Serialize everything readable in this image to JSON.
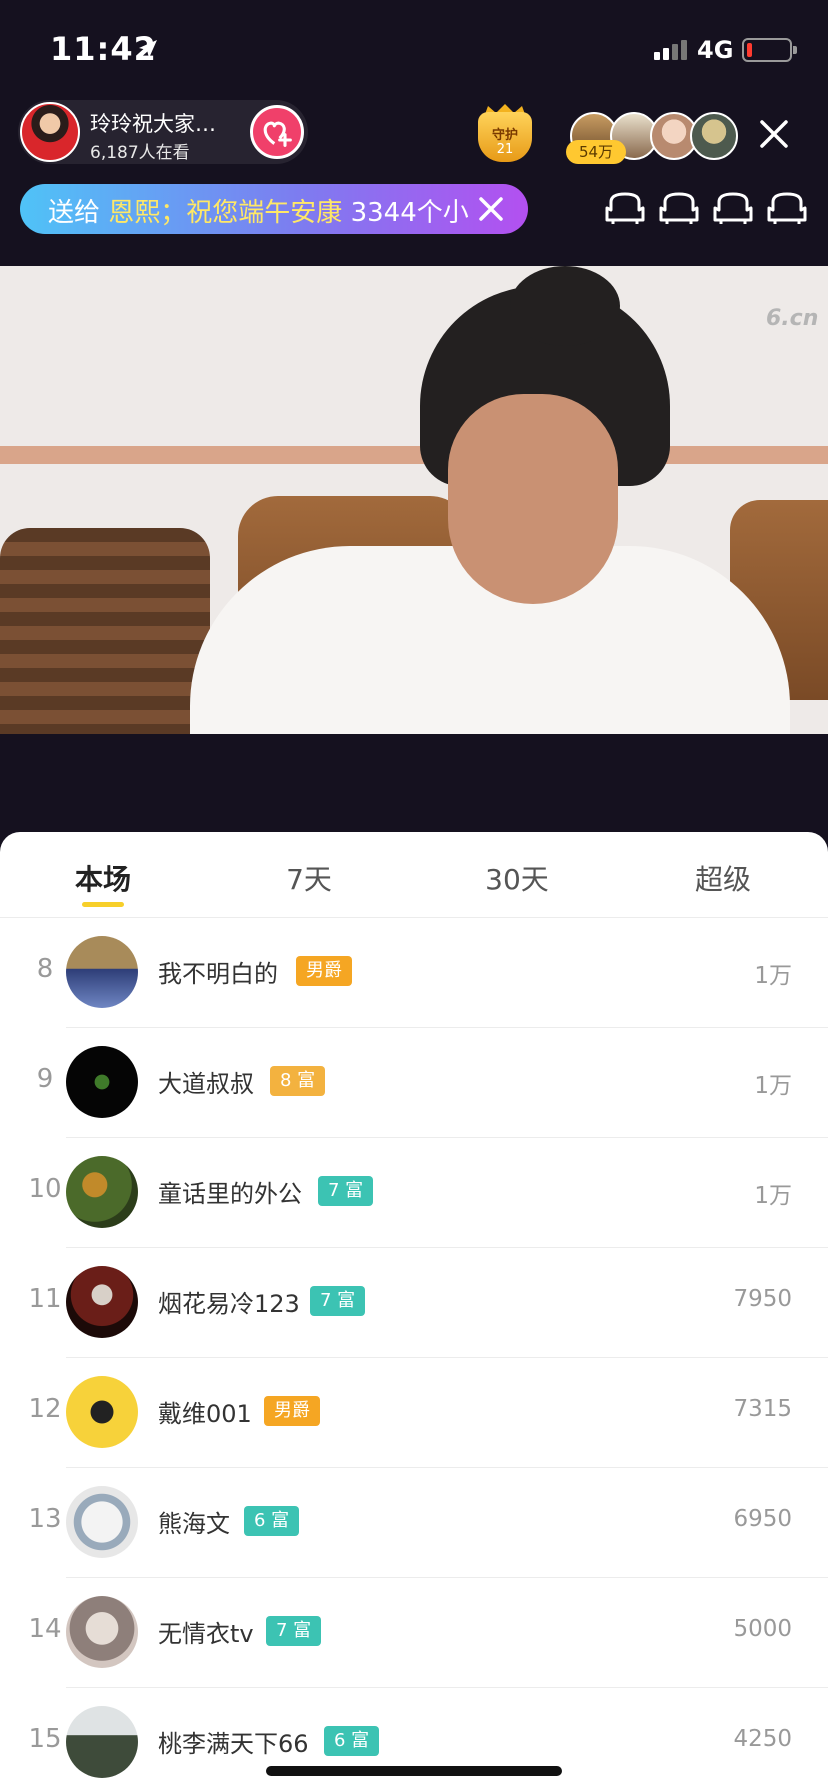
{
  "status_bar": {
    "time": "11:42",
    "network": "4G"
  },
  "host": {
    "name": "玲玲祝大家…",
    "viewers": "6,187人在看"
  },
  "guard": {
    "label": "守护",
    "count": "21"
  },
  "audience": {
    "badge": "54万"
  },
  "gift_banner": {
    "prefix": "送给",
    "recipient": "恩熙；",
    "message": "祝您端午安康",
    "suffix": "3344个小"
  },
  "video": {
    "watermark": "6.cn"
  },
  "tabs": [
    {
      "label": "本场"
    },
    {
      "label": "7天"
    },
    {
      "label": "30天"
    },
    {
      "label": "超级"
    }
  ],
  "ranking": [
    {
      "rank": "8",
      "name": "我不明白的",
      "badge": "男爵",
      "badge_color": "#f5a623",
      "score": "1万"
    },
    {
      "rank": "9",
      "name": "大道叔叔",
      "badge": "8 富",
      "badge_color": "#f3b23f",
      "score": "1万"
    },
    {
      "rank": "10",
      "name": "童话里的外公",
      "badge": "7 富",
      "badge_color": "#3cc3b3",
      "score": "1万"
    },
    {
      "rank": "11",
      "name": "烟花易冷123",
      "badge": "7 富",
      "badge_color": "#3cc3b3",
      "score": "7950"
    },
    {
      "rank": "12",
      "name": "戴维001",
      "badge": "男爵",
      "badge_color": "#f5a623",
      "score": "7315"
    },
    {
      "rank": "13",
      "name": "熊海文",
      "badge": "6 富",
      "badge_color": "#3cc3b3",
      "score": "6950"
    },
    {
      "rank": "14",
      "name": "无情衣tv",
      "badge": "7 富",
      "badge_color": "#3cc3b3",
      "score": "5000"
    },
    {
      "rank": "15",
      "name": "桃李满天下66",
      "badge": "6 富",
      "badge_color": "#3cc3b3",
      "score": "4250"
    }
  ],
  "colors": {
    "accent": "#f7cf2a",
    "follow": "#f0406a"
  }
}
